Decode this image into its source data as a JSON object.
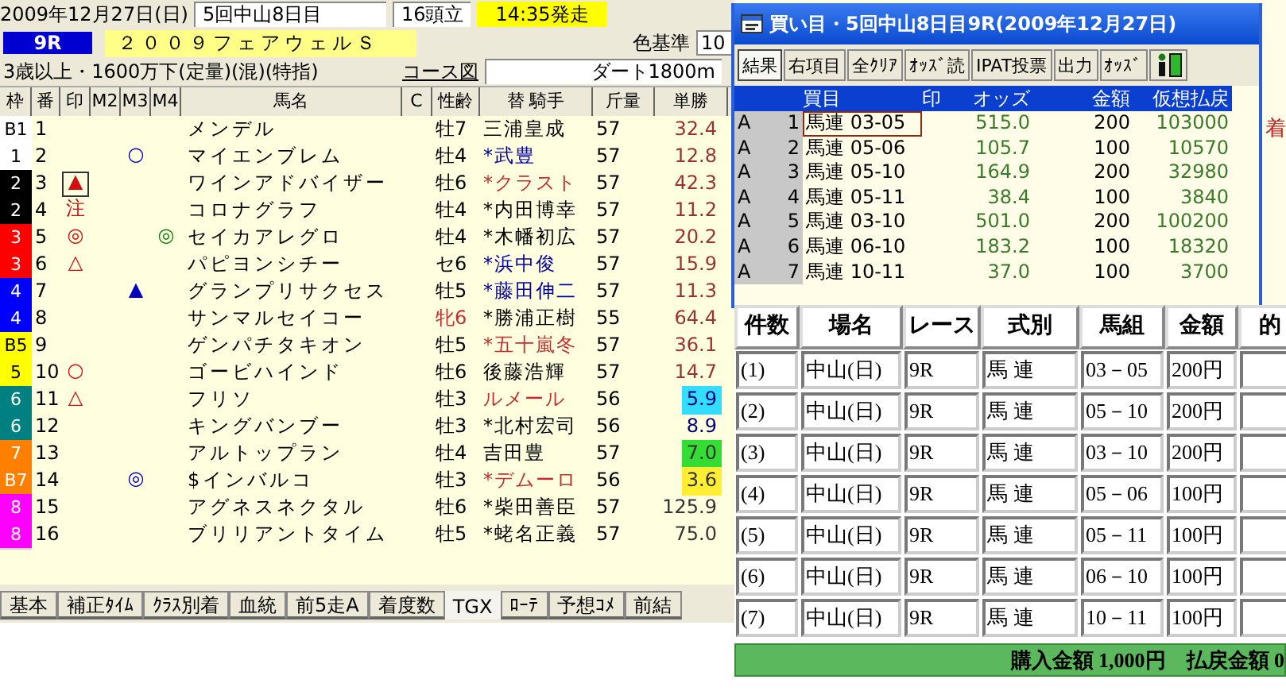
{
  "race": {
    "date": "2009年12月27日(日)",
    "meeting": "5回中山8日目",
    "runners": "16頭立",
    "post_time": "14:35発走",
    "color_label": "色基準",
    "color_value": "10",
    "number": "9R",
    "name": "２００９フェアウェルＳ",
    "conditions": "3歳以上・1600万下(定量)(混)(特指)",
    "course_link": "コース図",
    "course": "ダート1800m"
  },
  "table": {
    "columns": [
      "枠",
      "番",
      "印",
      "M2",
      "M3",
      "M4",
      "馬名",
      "C",
      "性齢",
      "替 騎手",
      "斤量",
      "単勝"
    ],
    "rows": [
      {
        "waku": {
          "label": "B1",
          "color": "#ffffff"
        },
        "num": "1",
        "name": "メンデル",
        "sex_age": "牡7",
        "female": false,
        "jockey": {
          "name": "三浦皇成",
          "color": "#000000"
        },
        "weight": "57",
        "odds": {
          "value": "32.4",
          "color": "#993333"
        },
        "focused": false
      },
      {
        "waku": {
          "label": "1",
          "color": "#ffffff"
        },
        "num": "2",
        "m3": "○",
        "name": "マイエンブレム",
        "sex_age": "牡4",
        "female": false,
        "jockey": {
          "name": "*武豊",
          "color": "#0000a0"
        },
        "weight": "57",
        "odds": {
          "value": "12.8",
          "color": "#993333"
        },
        "focused": false
      },
      {
        "waku": {
          "label": "2",
          "color": "#000000"
        },
        "num": "3",
        "mark": "▲",
        "name": "ワインアドバイザー",
        "sex_age": "牡6",
        "female": false,
        "jockey": {
          "name": "*クラスト",
          "color": "#c03030"
        },
        "weight": "57",
        "odds": {
          "value": "42.3",
          "color": "#993333"
        },
        "focused": true
      },
      {
        "waku": {
          "label": "2",
          "color": "#000000"
        },
        "num": "4",
        "mark": "注",
        "name": "コロナグラフ",
        "sex_age": "牡4",
        "female": false,
        "jockey": {
          "name": "*内田博幸",
          "color": "#000000"
        },
        "weight": "57",
        "odds": {
          "value": "11.2",
          "color": "#993333"
        },
        "focused": false
      },
      {
        "waku": {
          "label": "3",
          "color": "#ff0000"
        },
        "num": "5",
        "mark": "◎",
        "m4": "◎",
        "name": "セイカアレグロ",
        "sex_age": "牡4",
        "female": false,
        "jockey": {
          "name": "*木幡初広",
          "color": "#000000"
        },
        "weight": "57",
        "odds": {
          "value": "20.2",
          "color": "#993333"
        },
        "focused": false
      },
      {
        "waku": {
          "label": "3",
          "color": "#ff0000"
        },
        "num": "6",
        "mark": "△",
        "name": "パピヨンシチー",
        "sex_age": "セ6",
        "female": false,
        "jockey": {
          "name": "*浜中俊",
          "color": "#0000a0"
        },
        "weight": "57",
        "odds": {
          "value": "15.9",
          "color": "#993333"
        },
        "focused": false
      },
      {
        "waku": {
          "label": "4",
          "color": "#0000ff"
        },
        "num": "7",
        "m3": "▲",
        "name": "グランプリサクセス",
        "sex_age": "牡5",
        "female": false,
        "jockey": {
          "name": "*藤田伸二",
          "color": "#0000a0"
        },
        "weight": "57",
        "odds": {
          "value": "11.3",
          "color": "#993333"
        },
        "focused": false
      },
      {
        "waku": {
          "label": "4",
          "color": "#0000ff"
        },
        "num": "8",
        "name": "サンマルセイコー",
        "sex_age": "牝6",
        "female": true,
        "jockey": {
          "name": "*勝浦正樹",
          "color": "#000000"
        },
        "weight": "55",
        "odds": {
          "value": "64.4",
          "color": "#993333"
        },
        "focused": false
      },
      {
        "waku": {
          "label": "B5",
          "color": "#ffff00"
        },
        "num": "9",
        "name": "ゲンパチタキオン",
        "sex_age": "牡5",
        "female": false,
        "jockey": {
          "name": "*五十嵐冬",
          "color": "#c03030"
        },
        "weight": "57",
        "odds": {
          "value": "36.1",
          "color": "#993333"
        },
        "focused": false
      },
      {
        "waku": {
          "label": "5",
          "color": "#ffff00"
        },
        "num": "10",
        "mark": "○",
        "name": "ゴービハインド",
        "sex_age": "牡6",
        "female": false,
        "jockey": {
          "name": "後藤浩輝",
          "color": "#000000"
        },
        "weight": "57",
        "odds": {
          "value": "14.7",
          "color": "#993333"
        },
        "focused": false
      },
      {
        "waku": {
          "label": "6",
          "color": "#008080"
        },
        "num": "11",
        "mark": "△",
        "name": "フリソ",
        "sex_age": "牡3",
        "female": false,
        "jockey": {
          "name": "ルメール",
          "color": "#c03030"
        },
        "weight": "56",
        "odds": {
          "value": "5.9",
          "color": "#000080",
          "highlight": {
            "color": "#33ddff"
          }
        },
        "focused": false
      },
      {
        "waku": {
          "label": "6",
          "color": "#008080"
        },
        "num": "12",
        "name": "キングバンブー",
        "sex_age": "牡3",
        "female": false,
        "jockey": {
          "name": "*北村宏司",
          "color": "#000000"
        },
        "weight": "56",
        "odds": {
          "value": "8.9",
          "color": "#000080"
        },
        "focused": false
      },
      {
        "waku": {
          "label": "7",
          "color": "#ff8000"
        },
        "num": "13",
        "name": "アルトップラン",
        "sex_age": "牡4",
        "female": false,
        "jockey": {
          "name": "吉田豊",
          "color": "#000000"
        },
        "weight": "57",
        "odds": {
          "value": "7.0",
          "color": "#333333",
          "highlight": {
            "color": "#33dd33"
          }
        },
        "focused": false
      },
      {
        "waku": {
          "label": "B7",
          "color": "#ff8000"
        },
        "num": "14",
        "m3": "◎",
        "name": "$インバルコ",
        "sex_age": "牡3",
        "female": false,
        "jockey": {
          "name": "*デムーロ",
          "color": "#c03030"
        },
        "weight": "56",
        "odds": {
          "value": "3.6",
          "color": "#333333",
          "highlight": {
            "color": "#ffee33"
          }
        },
        "focused": false
      },
      {
        "waku": {
          "label": "8",
          "color": "#ff00ff"
        },
        "num": "15",
        "name": "アグネスネクタル",
        "sex_age": "牡6",
        "female": false,
        "jockey": {
          "name": "*柴田善臣",
          "color": "#000000"
        },
        "weight": "57",
        "odds": {
          "value": "125.9",
          "color": "#333333"
        },
        "focused": false
      },
      {
        "waku": {
          "label": "8",
          "color": "#ff00ff"
        },
        "num": "16",
        "name": "ブリリアントタイム",
        "sex_age": "牡5",
        "female": false,
        "jockey": {
          "name": "*蛯名正義",
          "color": "#000000"
        },
        "weight": "57",
        "odds": {
          "value": "75.0",
          "color": "#333333"
        },
        "focused": false
      }
    ]
  },
  "tabs": [
    {
      "label": "基本",
      "selected": false
    },
    {
      "label": "補正ﾀｲﾑ",
      "selected": false
    },
    {
      "label": "ｸﾗｽ別着",
      "selected": false
    },
    {
      "label": "血統",
      "selected": false
    },
    {
      "label": "前5走A",
      "selected": false
    },
    {
      "label": "着度数",
      "selected": false
    },
    {
      "label": "TGX",
      "selected": true
    },
    {
      "label": "ﾛｰﾃ",
      "selected": false
    },
    {
      "label": "予想ｺﾒ",
      "selected": false
    },
    {
      "label": "前結",
      "selected": false
    }
  ],
  "back_window": {
    "label": "着"
  },
  "bets_window": {
    "title": "買い目・5回中山8日目9R(2009年12月27日)",
    "toolbar": [
      {
        "label": "結果",
        "selected": true
      },
      {
        "label": "右項目",
        "selected": false
      },
      {
        "label": "全ｸﾘｱ",
        "selected": false
      },
      {
        "label": "ｵｯｽﾞ読",
        "selected": false
      },
      {
        "label": "IPAT投票",
        "selected": false
      },
      {
        "label": "出力",
        "selected": false
      },
      {
        "label": "ｵｯｽﾞ",
        "selected": false
      }
    ],
    "columns": [
      "買目",
      "印",
      "オッズ",
      "金額",
      "仮想払戻"
    ],
    "rows": [
      {
        "group": "A",
        "no": "1",
        "bet": "馬連 03-05",
        "odds": "515.0",
        "amount": "200",
        "payout": "103000",
        "selected": true
      },
      {
        "group": "A",
        "no": "2",
        "bet": "馬連 05-06",
        "odds": "105.7",
        "amount": "100",
        "payout": "10570",
        "selected": false
      },
      {
        "group": "A",
        "no": "3",
        "bet": "馬連 05-10",
        "odds": "164.9",
        "amount": "200",
        "payout": "32980",
        "selected": false
      },
      {
        "group": "A",
        "no": "4",
        "bet": "馬連 05-11",
        "odds": "38.4",
        "amount": "100",
        "payout": "3840",
        "selected": false
      },
      {
        "group": "A",
        "no": "5",
        "bet": "馬連 03-10",
        "odds": "501.0",
        "amount": "200",
        "payout": "100200",
        "selected": false
      },
      {
        "group": "A",
        "no": "6",
        "bet": "馬連 06-10",
        "odds": "183.2",
        "amount": "100",
        "payout": "18320",
        "selected": false
      },
      {
        "group": "A",
        "no": "7",
        "bet": "馬連 10-11",
        "odds": "37.0",
        "amount": "100",
        "payout": "3700",
        "selected": false
      }
    ]
  },
  "ticket": {
    "columns": [
      "件数",
      "場名",
      "レース",
      "式別",
      "馬組",
      "金額",
      "的"
    ],
    "rows": [
      [
        "(1)",
        "中山(日)",
        "9R",
        "馬 連",
        "03－05",
        "200円"
      ],
      [
        "(2)",
        "中山(日)",
        "9R",
        "馬 連",
        "05－10",
        "200円"
      ],
      [
        "(3)",
        "中山(日)",
        "9R",
        "馬 連",
        "03－10",
        "200円"
      ],
      [
        "(4)",
        "中山(日)",
        "9R",
        "馬 連",
        "05－06",
        "100円"
      ],
      [
        "(5)",
        "中山(日)",
        "9R",
        "馬 連",
        "05－11",
        "100円"
      ],
      [
        "(6)",
        "中山(日)",
        "9R",
        "馬 連",
        "06－10",
        "100円"
      ],
      [
        "(7)",
        "中山(日)",
        "9R",
        "馬 連",
        "10－11",
        "100円"
      ]
    ],
    "total": "購入金額 1,000円　払戻金額 0"
  }
}
